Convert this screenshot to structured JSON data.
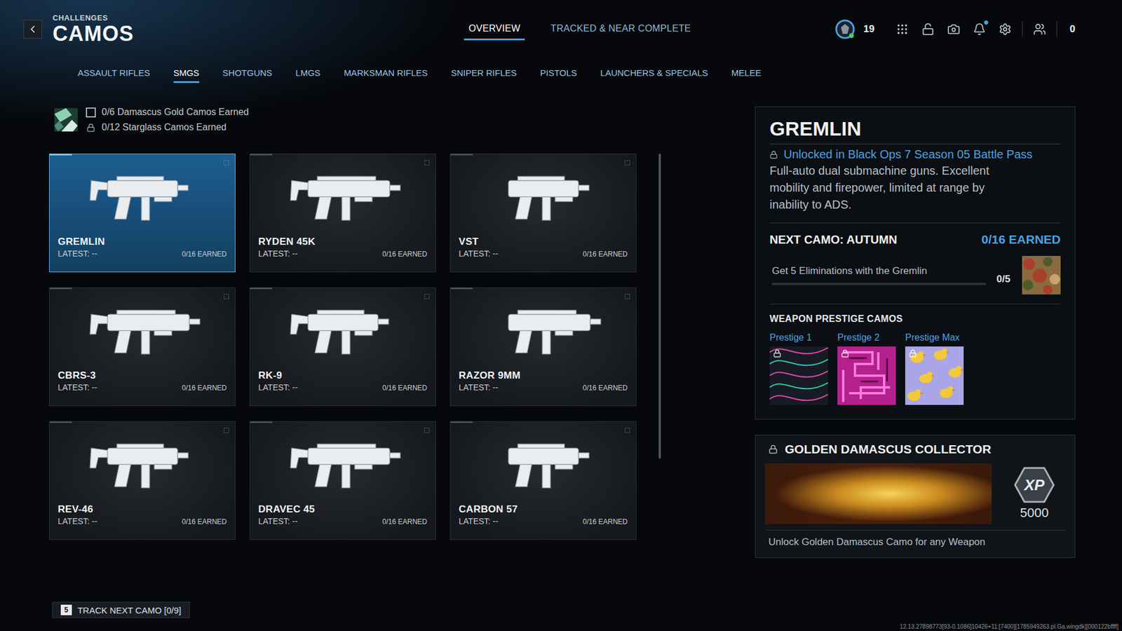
{
  "header": {
    "section": "CHALLENGES",
    "title": "CAMOS"
  },
  "nav_tabs": [
    {
      "label": "OVERVIEW",
      "selected": true
    },
    {
      "label": "TRACKED & NEAR COMPLETE",
      "selected": false
    }
  ],
  "status": {
    "rank": "19",
    "currency": "0",
    "notification": true
  },
  "categories": [
    {
      "label": "ASSAULT RIFLES",
      "selected": false
    },
    {
      "label": "SMGS",
      "selected": true
    },
    {
      "label": "SHOTGUNS",
      "selected": false
    },
    {
      "label": "LMGS",
      "selected": false
    },
    {
      "label": "MARKSMAN RIFLES",
      "selected": false
    },
    {
      "label": "SNIPER RIFLES",
      "selected": false
    },
    {
      "label": "PISTOLS",
      "selected": false
    },
    {
      "label": "LAUNCHERS & SPECIALS",
      "selected": false
    },
    {
      "label": "MELEE",
      "selected": false
    }
  ],
  "summary": [
    {
      "text": "0/6 Damascus Gold Camos Earned",
      "kind": "checkbox",
      "checked": false
    },
    {
      "text": "0/12 Starglass Camos Earned",
      "kind": "locked",
      "checked": false
    }
  ],
  "weapons": [
    {
      "name": "GREMLIN",
      "latest": "LATEST: --",
      "earned": "0/16 EARNED",
      "selected": true
    },
    {
      "name": "RYDEN 45K",
      "latest": "LATEST: --",
      "earned": "0/16 EARNED",
      "selected": false
    },
    {
      "name": "VST",
      "latest": "LATEST: --",
      "earned": "0/16 EARNED",
      "selected": false
    },
    {
      "name": "CBRS-3",
      "latest": "LATEST: --",
      "earned": "0/16 EARNED",
      "selected": false
    },
    {
      "name": "RK-9",
      "latest": "LATEST: --",
      "earned": "0/16 EARNED",
      "selected": false
    },
    {
      "name": "RAZOR 9MM",
      "latest": "LATEST: --",
      "earned": "0/16 EARNED",
      "selected": false
    },
    {
      "name": "REV-46",
      "latest": "LATEST: --",
      "earned": "0/16 EARNED",
      "selected": false
    },
    {
      "name": "DRAVEC 45",
      "latest": "LATEST: --",
      "earned": "0/16 EARNED",
      "selected": false
    },
    {
      "name": "CARBON 57",
      "latest": "LATEST: --",
      "earned": "0/16 EARNED",
      "selected": false
    }
  ],
  "detail": {
    "name": "GREMLIN",
    "unlock": "Unlocked in Black Ops 7 Season 05 Battle Pass",
    "description": "Full-auto dual submachine guns. Excellent mobility and firepower, limited at range by inability to ADS.",
    "next_camo": "NEXT CAMO: AUTUMN",
    "earned": "0/16 EARNED",
    "challenge": "Get 5 Eliminations with the Gremlin",
    "progress": "0/5",
    "level": 0,
    "prestige_title": "WEAPON PRESTIGE CAMOS"
  },
  "prestige": [
    {
      "label": "Prestige 1",
      "locked": true
    },
    {
      "label": "Prestige 2",
      "locked": true
    },
    {
      "label": "Prestige Max",
      "locked": true
    }
  ],
  "reward": {
    "title": "GOLDEN DAMASCUS COLLECTOR",
    "locked": true,
    "badge": "XP",
    "amount": "5000",
    "description": "Unlock Golden Damascus Camo for any Weapon"
  },
  "track": {
    "key": "5",
    "label": "TRACK NEXT CAMO [0/9]"
  },
  "build": "12.13.27898773[93-0.1086]10426+11:[7400][1785949263.pl.Ga.wingdk][000122bffff]"
}
